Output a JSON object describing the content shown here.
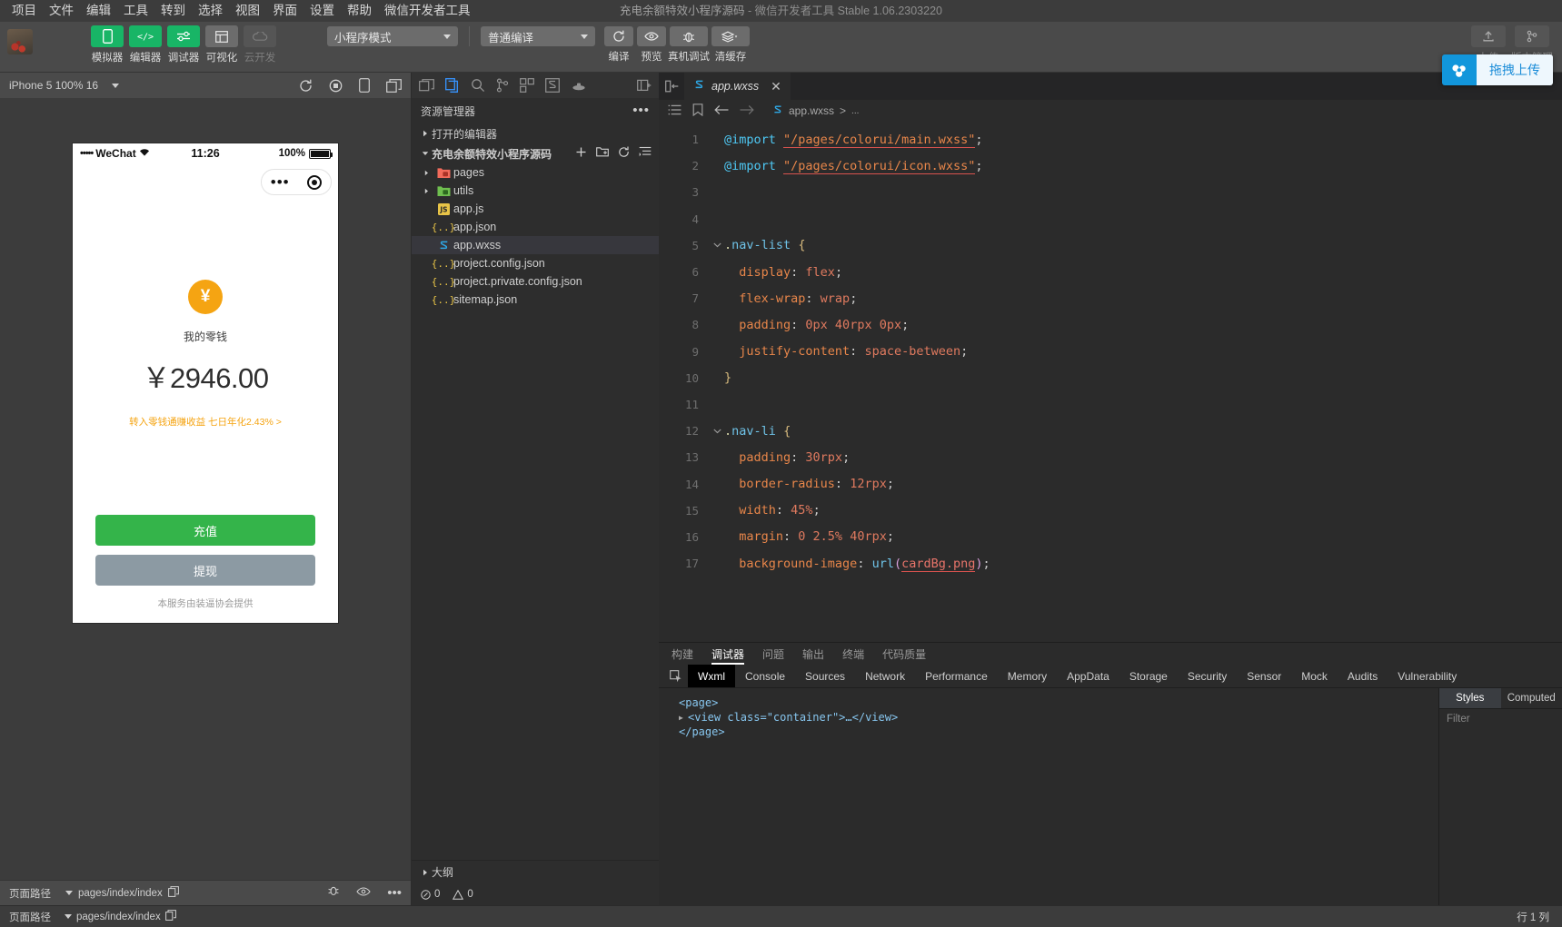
{
  "menubar": {
    "items": [
      "项目",
      "文件",
      "编辑",
      "工具",
      "转到",
      "选择",
      "视图",
      "界面",
      "设置",
      "帮助",
      "微信开发者工具"
    ],
    "window_title": "充电余额特效小程序源码",
    "window_title_sep": "-",
    "window_title_sub": "微信开发者工具 Stable 1.06.2303220"
  },
  "toolbar": {
    "modes": [
      {
        "label": "模拟器",
        "icon": "phone-icon",
        "state": "green"
      },
      {
        "label": "编辑器",
        "icon": "code-icon",
        "state": "green"
      },
      {
        "label": "调试器",
        "icon": "sliders-icon",
        "state": "green"
      },
      {
        "label": "可视化",
        "icon": "layout-icon",
        "state": "grey"
      },
      {
        "label": "云开发",
        "icon": "cloud-icon",
        "state": "disabled"
      }
    ],
    "project_mode": "小程序模式",
    "compile_mode": "普通编译",
    "actions": [
      {
        "label": "编译",
        "icon": "refresh-icon"
      },
      {
        "label": "预览",
        "icon": "eye-icon"
      },
      {
        "label": "真机调试",
        "icon": "bug-icon"
      },
      {
        "label": "清缓存",
        "icon": "layers-icon"
      }
    ],
    "upload_label": "上传",
    "version_label": "版本管理",
    "drag_upload": "拖拽上传"
  },
  "simulator": {
    "device": "iPhone 5 100% 16",
    "status": {
      "carrier_dots": "•••••",
      "carrier": "WeChat",
      "time": "11:26",
      "battery_percent": "100%"
    },
    "page": {
      "coin_symbol": "¥",
      "label": "我的零钱",
      "balance": "￥2946.00",
      "promo": "转入零钱通赚收益 七日年化2.43% >",
      "recharge_button": "充值",
      "withdraw_button": "提现",
      "footnote": "本服务由装逼协会提供"
    },
    "footer": {
      "path_label": "页面路径",
      "path_value": "pages/index/index"
    }
  },
  "explorer": {
    "title": "资源管理器",
    "open_editors": "打开的编辑器",
    "project": "充电余额特效小程序源码",
    "files": [
      {
        "name": "pages",
        "type": "folder",
        "icon": "folder-red-icon",
        "expanded": false,
        "depth": 1
      },
      {
        "name": "utils",
        "type": "folder",
        "icon": "folder-green-icon",
        "expanded": false,
        "depth": 1
      },
      {
        "name": "app.js",
        "type": "js",
        "icon": "js-icon",
        "depth": 1
      },
      {
        "name": "app.json",
        "type": "json",
        "icon": "json-icon",
        "depth": 1
      },
      {
        "name": "app.wxss",
        "type": "wxss",
        "icon": "wxss-icon",
        "depth": 1,
        "selected": true
      },
      {
        "name": "project.config.json",
        "type": "json",
        "icon": "json-icon",
        "depth": 1
      },
      {
        "name": "project.private.config.json",
        "type": "json",
        "icon": "json-icon",
        "depth": 1
      },
      {
        "name": "sitemap.json",
        "type": "json",
        "icon": "json-icon",
        "depth": 1
      }
    ],
    "outline": "大纲",
    "problems": {
      "errors": "0",
      "warnings": "0"
    }
  },
  "editor": {
    "tab": "app.wxss",
    "breadcrumb": [
      "app.wxss",
      "..."
    ],
    "lines": [
      {
        "n": 1,
        "fold": "",
        "tokens": [
          {
            "t": "@import ",
            "c": "k-at"
          },
          {
            "t": "\"/pages/colorui/main.wxss\"",
            "c": "k-str"
          },
          {
            "t": ";",
            "c": "k-punc"
          }
        ]
      },
      {
        "n": 2,
        "fold": "",
        "tokens": [
          {
            "t": "@import ",
            "c": "k-at"
          },
          {
            "t": "\"/pages/colorui/icon.wxss\"",
            "c": "k-str"
          },
          {
            "t": ";",
            "c": "k-punc"
          }
        ]
      },
      {
        "n": 3,
        "fold": "",
        "tokens": []
      },
      {
        "n": 4,
        "fold": "",
        "tokens": []
      },
      {
        "n": 5,
        "fold": "v",
        "tokens": [
          {
            "t": ".",
            "c": "k-dot"
          },
          {
            "t": "nav-list",
            "c": "k-sel"
          },
          {
            "t": " ",
            "c": "k-punc"
          },
          {
            "t": "{",
            "c": "k-brace"
          }
        ]
      },
      {
        "n": 6,
        "fold": "",
        "tokens": [
          {
            "t": "  display",
            "c": "k-prop"
          },
          {
            "t": ": ",
            "c": "k-punc"
          },
          {
            "t": "flex",
            "c": "k-val"
          },
          {
            "t": ";",
            "c": "k-punc"
          }
        ]
      },
      {
        "n": 7,
        "fold": "",
        "tokens": [
          {
            "t": "  flex-wrap",
            "c": "k-prop"
          },
          {
            "t": ": ",
            "c": "k-punc"
          },
          {
            "t": "wrap",
            "c": "k-val"
          },
          {
            "t": ";",
            "c": "k-punc"
          }
        ]
      },
      {
        "n": 8,
        "fold": "",
        "tokens": [
          {
            "t": "  padding",
            "c": "k-prop"
          },
          {
            "t": ": ",
            "c": "k-punc"
          },
          {
            "t": "0px 40rpx 0px",
            "c": "k-num"
          },
          {
            "t": ";",
            "c": "k-punc"
          }
        ]
      },
      {
        "n": 9,
        "fold": "",
        "tokens": [
          {
            "t": "  justify-content",
            "c": "k-prop"
          },
          {
            "t": ": ",
            "c": "k-punc"
          },
          {
            "t": "space-between",
            "c": "k-val"
          },
          {
            "t": ";",
            "c": "k-punc"
          }
        ]
      },
      {
        "n": 10,
        "fold": "",
        "tokens": [
          {
            "t": "}",
            "c": "k-brace"
          }
        ]
      },
      {
        "n": 11,
        "fold": "",
        "tokens": []
      },
      {
        "n": 12,
        "fold": "v",
        "tokens": [
          {
            "t": ".",
            "c": "k-dot"
          },
          {
            "t": "nav-li",
            "c": "k-sel"
          },
          {
            "t": " ",
            "c": "k-punc"
          },
          {
            "t": "{",
            "c": "k-brace"
          }
        ]
      },
      {
        "n": 13,
        "fold": "",
        "tokens": [
          {
            "t": "  padding",
            "c": "k-prop"
          },
          {
            "t": ": ",
            "c": "k-punc"
          },
          {
            "t": "30rpx",
            "c": "k-num"
          },
          {
            "t": ";",
            "c": "k-punc"
          }
        ]
      },
      {
        "n": 14,
        "fold": "",
        "tokens": [
          {
            "t": "  border-radius",
            "c": "k-prop"
          },
          {
            "t": ": ",
            "c": "k-punc"
          },
          {
            "t": "12rpx",
            "c": "k-num"
          },
          {
            "t": ";",
            "c": "k-punc"
          }
        ]
      },
      {
        "n": 15,
        "fold": "",
        "tokens": [
          {
            "t": "  width",
            "c": "k-prop"
          },
          {
            "t": ": ",
            "c": "k-punc"
          },
          {
            "t": "45%",
            "c": "k-num"
          },
          {
            "t": ";",
            "c": "k-punc"
          }
        ]
      },
      {
        "n": 16,
        "fold": "",
        "tokens": [
          {
            "t": "  margin",
            "c": "k-prop"
          },
          {
            "t": ": ",
            "c": "k-punc"
          },
          {
            "t": "0 2.5% 40rpx",
            "c": "k-num"
          },
          {
            "t": ";",
            "c": "k-punc"
          }
        ]
      },
      {
        "n": 17,
        "fold": "",
        "tokens": [
          {
            "t": "  background-image",
            "c": "k-prop"
          },
          {
            "t": ": ",
            "c": "k-punc"
          },
          {
            "t": "url",
            "c": "k-sel"
          },
          {
            "t": "(",
            "c": "k-fn"
          },
          {
            "t": "cardBg.png",
            "c": "k-url"
          },
          {
            "t": ")",
            "c": "k-fn"
          },
          {
            "t": ";",
            "c": "k-punc"
          }
        ]
      }
    ]
  },
  "debugger": {
    "panel_tabs": [
      "构建",
      "调试器",
      "问题",
      "输出",
      "终端",
      "代码质量"
    ],
    "panel_active": "调试器",
    "devtools_tabs": [
      "Wxml",
      "Console",
      "Sources",
      "Network",
      "Performance",
      "Memory",
      "AppData",
      "Storage",
      "Security",
      "Sensor",
      "Mock",
      "Audits",
      "Vulnerability"
    ],
    "devtools_active": "Wxml",
    "wxml": [
      {
        "indent": 0,
        "tri": "",
        "text": "<page>"
      },
      {
        "indent": 1,
        "tri": "▶",
        "text": "<view class=\"container\">…</view>"
      },
      {
        "indent": 0,
        "tri": "",
        "text": "</page>"
      }
    ],
    "styles_tabs": [
      "Styles",
      "Computed"
    ],
    "styles_active": "Styles",
    "filter_placeholder": "Filter"
  },
  "statusbar": {
    "path_label": "页面路径",
    "path_value": "pages/index/index",
    "line_col": "行 1 列"
  },
  "colors": {
    "accent_green": "#18b566",
    "orange": "#f5a412",
    "blue": "#1296db",
    "bg": "#3c3c3c",
    "editor_bg": "#2b2b2b"
  }
}
